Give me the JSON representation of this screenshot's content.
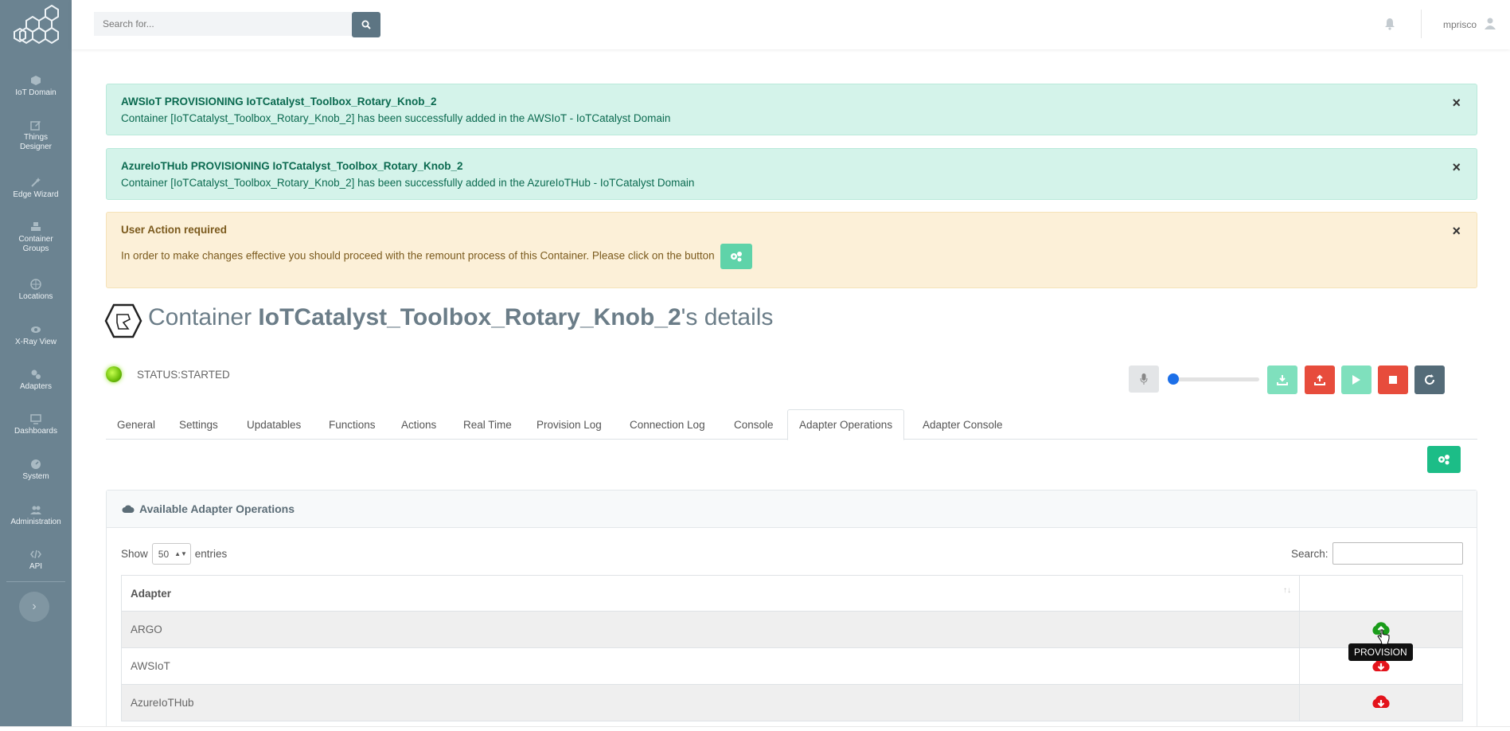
{
  "sidebar": {
    "items": [
      {
        "label": "IoT Domain",
        "icon": "cube-icon"
      },
      {
        "label": "Things Designer",
        "icon": "edit-icon"
      },
      {
        "label": "Edge Wizard",
        "icon": "wand-icon"
      },
      {
        "label": "Container Groups",
        "icon": "cubes-icon"
      },
      {
        "label": "Locations",
        "icon": "globe-icon"
      },
      {
        "label": "X-Ray View",
        "icon": "eye-icon"
      },
      {
        "label": "Adapters",
        "icon": "gears-icon"
      },
      {
        "label": "Dashboards",
        "icon": "monitor-icon"
      },
      {
        "label": "System",
        "icon": "dashboard-icon"
      },
      {
        "label": "Administration",
        "icon": "users-icon"
      },
      {
        "label": "API",
        "icon": "code-icon"
      }
    ]
  },
  "topbar": {
    "search_placeholder": "Search for...",
    "username": "mprisco"
  },
  "alerts": [
    {
      "title": "AWSIoT PROVISIONING IoTCatalyst_Toolbox_Rotary_Knob_2",
      "message": "Container [IoTCatalyst_Toolbox_Rotary_Knob_2] has been successfully added in the AWSIoT - IoTCatalyst Domain"
    },
    {
      "title": "AzureIoTHub PROVISIONING IoTCatalyst_Toolbox_Rotary_Knob_2",
      "message": "Container [IoTCatalyst_Toolbox_Rotary_Knob_2] has been successfully added in the AzureIoTHub - IoTCatalyst Domain"
    },
    {
      "title": "User Action required",
      "message": "In order to make changes effective you should proceed with the remount process of this Container. Please click on the button"
    }
  ],
  "title": {
    "prefix": "Container ",
    "name": "IoTCatalyst_Toolbox_Rotary_Knob_2",
    "suffix": "'s details"
  },
  "status": {
    "text": "STATUS:STARTED",
    "color": "#7ccf10"
  },
  "tabs": [
    "General",
    "Settings",
    "Updatables",
    "Functions",
    "Actions",
    "Real Time",
    "Provision Log",
    "Connection Log",
    "Console",
    "Adapter Operations",
    "Adapter Console"
  ],
  "active_tab": "Adapter Operations",
  "card": {
    "title": "Available Adapter Operations",
    "show_label": "Show",
    "entries_value": "50",
    "entries_label": "entries",
    "search_label": "Search:"
  },
  "table": {
    "header": "Adapter",
    "rows": [
      {
        "adapter": "ARGO",
        "action": "provision",
        "color": "#1a9c1a"
      },
      {
        "adapter": "AWSIoT",
        "action": "deprovision",
        "color": "#e3131b"
      },
      {
        "adapter": "AzureIoTHub",
        "action": "deprovision",
        "color": "#e3131b"
      }
    ]
  },
  "tooltip": "PROVISION",
  "colors": {
    "sidebar": "#6b8391",
    "success_bg": "#d4f3ea",
    "warning_bg": "#fcf0d8",
    "primary_green": "#1cbd87",
    "danger_red": "#e74c3c"
  }
}
